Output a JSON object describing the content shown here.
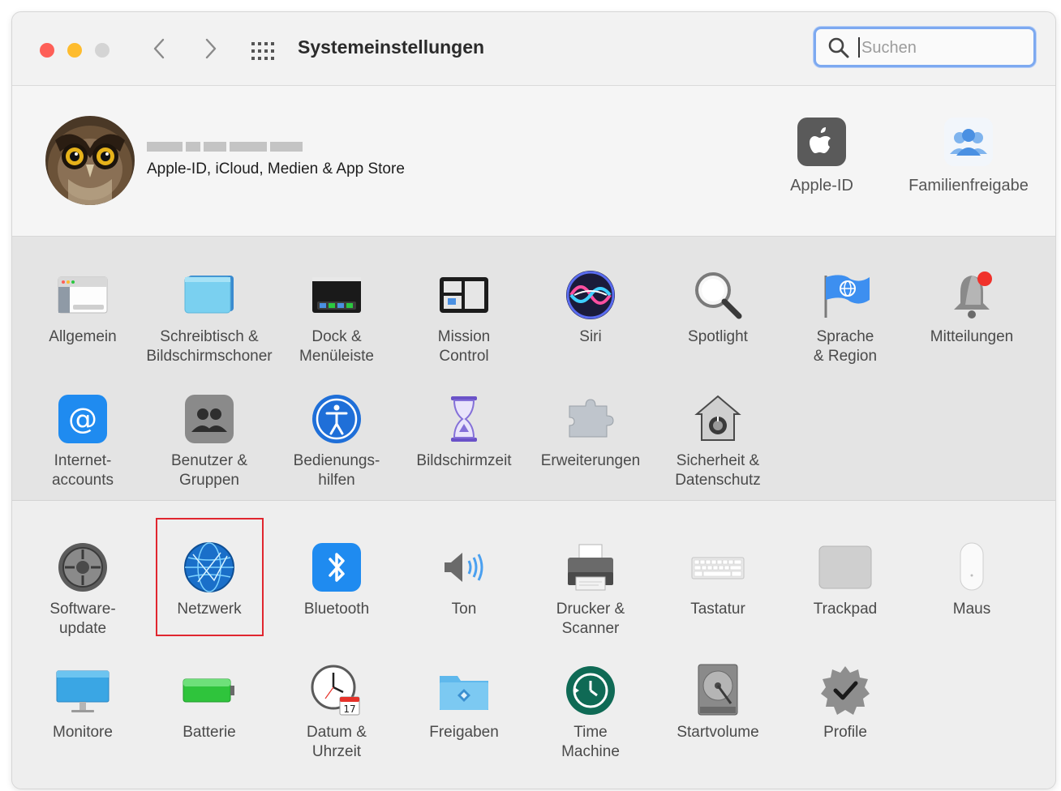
{
  "window": {
    "title": "Systemeinstellungen",
    "search": {
      "placeholder": "Suchen",
      "value": ""
    }
  },
  "account": {
    "name_blurred": true,
    "subtitle": "Apple-ID, iCloud, Medien & App Store",
    "items": [
      {
        "label": "Apple-ID",
        "icon": "apple-id-icon"
      },
      {
        "label": "Familienfreigabe",
        "icon": "family-sharing-icon"
      }
    ]
  },
  "panes_row1": [
    {
      "label": "Allgemein",
      "icon": "general-icon"
    },
    {
      "label": "Schreibtisch &\nBildschirmschoner",
      "icon": "desktop-icon"
    },
    {
      "label": "Dock &\nMenüleiste",
      "icon": "dock-icon"
    },
    {
      "label": "Mission\nControl",
      "icon": "mission-control-icon"
    },
    {
      "label": "Siri",
      "icon": "siri-icon"
    },
    {
      "label": "Spotlight",
      "icon": "spotlight-icon"
    },
    {
      "label": "Sprache\n& Region",
      "icon": "language-region-icon"
    },
    {
      "label": "Mitteilungen",
      "icon": "notifications-icon"
    }
  ],
  "panes_row2": [
    {
      "label": "Internet-\naccounts",
      "icon": "internet-accounts-icon"
    },
    {
      "label": "Benutzer &\nGruppen",
      "icon": "users-groups-icon"
    },
    {
      "label": "Bedienungs-\nhilfen",
      "icon": "accessibility-icon"
    },
    {
      "label": "Bildschirmzeit",
      "icon": "screen-time-icon"
    },
    {
      "label": "Erweiterungen",
      "icon": "extensions-icon"
    },
    {
      "label": "Sicherheit &\nDatenschutz",
      "icon": "security-icon"
    }
  ],
  "panes_row3": [
    {
      "label": "Software-\nupdate",
      "icon": "software-update-icon"
    },
    {
      "label": "Netzwerk",
      "icon": "network-icon",
      "highlighted": true
    },
    {
      "label": "Bluetooth",
      "icon": "bluetooth-icon"
    },
    {
      "label": "Ton",
      "icon": "sound-icon"
    },
    {
      "label": "Drucker &\nScanner",
      "icon": "printer-icon"
    },
    {
      "label": "Tastatur",
      "icon": "keyboard-icon"
    },
    {
      "label": "Trackpad",
      "icon": "trackpad-icon"
    },
    {
      "label": "Maus",
      "icon": "mouse-icon"
    }
  ],
  "panes_row4": [
    {
      "label": "Monitore",
      "icon": "displays-icon"
    },
    {
      "label": "Batterie",
      "icon": "battery-icon"
    },
    {
      "label": "Datum &\nUhrzeit",
      "icon": "date-time-icon",
      "calendar_day": "17"
    },
    {
      "label": "Freigaben",
      "icon": "sharing-icon"
    },
    {
      "label": "Time\nMachine",
      "icon": "time-machine-icon"
    },
    {
      "label": "Startvolume",
      "icon": "startup-disk-icon"
    },
    {
      "label": "Profile",
      "icon": "profiles-icon"
    }
  ],
  "colors": {
    "close": "#fe5f57",
    "minimize": "#febc2e",
    "focus_ring": "#7da9f0",
    "highlight_box": "#e0262f"
  }
}
